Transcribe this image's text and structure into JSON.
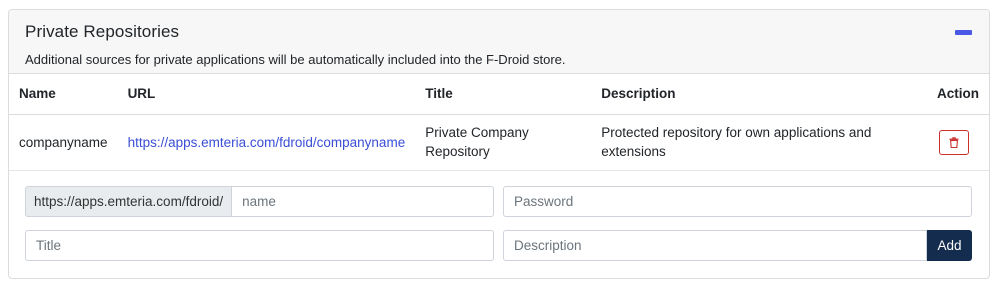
{
  "panel": {
    "title": "Private Repositories",
    "subtitle": "Additional sources for private applications will be automatically included into the F-Droid store.",
    "collapse_icon": "minus-icon"
  },
  "table": {
    "headers": {
      "name": "Name",
      "url": "URL",
      "title": "Title",
      "description": "Description",
      "action": "Action"
    },
    "rows": [
      {
        "name": "companyname",
        "url": "https://apps.emteria.com/fdroid/companyname",
        "title": "Private Company Repository",
        "description": "Protected repository for own applications and extensions",
        "action_icon": "trash-icon"
      }
    ]
  },
  "form": {
    "url_prefix": "https://apps.emteria.com/fdroid/",
    "name_placeholder": "name",
    "password_placeholder": "Password",
    "title_placeholder": "Title",
    "description_placeholder": "Description",
    "add_label": "Add"
  },
  "colors": {
    "accent": "#4a58e6",
    "link": "#3a4ed6",
    "danger": "#c9302c",
    "primary_button": "#142c4e"
  }
}
